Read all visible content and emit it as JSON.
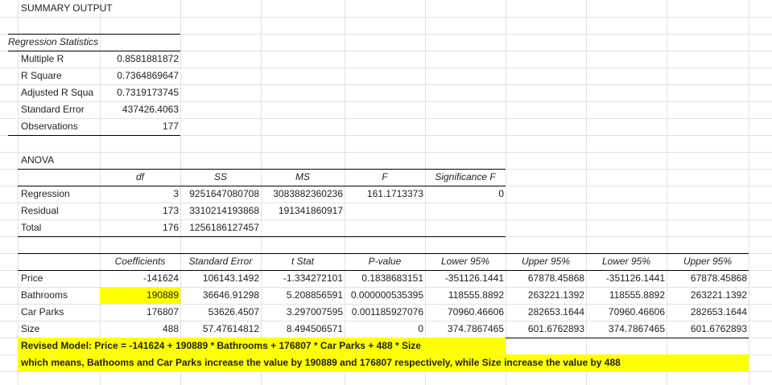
{
  "summary_title": "SUMMARY OUTPUT",
  "regression_statistics": {
    "header": "Regression Statistics",
    "rows": [
      {
        "label": "Multiple R",
        "value": "0.8581881872"
      },
      {
        "label": "R Square",
        "value": "0.7364869647"
      },
      {
        "label": "Adjusted R Squa",
        "value": "0.7319173745"
      },
      {
        "label": "Standard Error",
        "value": "437426.4063"
      },
      {
        "label": "Observations",
        "value": "177"
      }
    ]
  },
  "anova": {
    "title": "ANOVA",
    "headers": [
      "df",
      "SS",
      "MS",
      "F",
      "Significance F"
    ],
    "rows": [
      {
        "label": "Regression",
        "df": "3",
        "ss": "9251647080708",
        "ms": "3083882360236",
        "f": "161.1713373",
        "sigf": "0"
      },
      {
        "label": "Residual",
        "df": "173",
        "ss": "3310214193868",
        "ms": "191341860917",
        "f": "",
        "sigf": ""
      },
      {
        "label": "Total",
        "df": "176",
        "ss": "1256186127457",
        "ms": "",
        "f": "",
        "sigf": ""
      }
    ]
  },
  "coefficients": {
    "headers": [
      "Coefficients",
      "Standard Error",
      "t Stat",
      "P-value",
      "Lower 95%",
      "Upper 95%",
      "Lower 95%",
      "Upper 95%"
    ],
    "rows": [
      {
        "label": "Price",
        "coef": "-141624",
        "se": "106143.1492",
        "t": "-1.334272101",
        "p": "0.1838683151",
        "l95": "-351126.1441",
        "u95": "67878.45868",
        "l95b": "-351126.1441",
        "u95b": "67878.45868"
      },
      {
        "label": "Bathrooms",
        "coef": "190889",
        "se": "36646.91298",
        "t": "5.208856591",
        "p": "0.000000535395",
        "l95": "118555.8892",
        "u95": "263221.1392",
        "l95b": "118555.8892",
        "u95b": "263221.1392"
      },
      {
        "label": "Car Parks",
        "coef": "176807",
        "se": "53626.4507",
        "t": "3.297007595",
        "p": "0.001185927076",
        "l95": "70960.46606",
        "u95": "282653.1644",
        "l95b": "70960.46606",
        "u95b": "282653.1644"
      },
      {
        "label": "Size",
        "coef": "488",
        "se": "57.47614812",
        "t": "8.494506571",
        "p": "0",
        "l95": "374.7867465",
        "u95": "601.6762893",
        "l95b": "374.7867465",
        "u95b": "601.6762893"
      }
    ]
  },
  "highlight_color": "#ffff00",
  "notes": {
    "model": "Revised Model: Price = -141624 + 190889 * Bathrooms + 176807 * Car Parks + 488 * Size",
    "meaning": "which means, Bathooms and Car Parks increase the value by 190889 and 176807 respectively, while Size increase the value by 488"
  }
}
